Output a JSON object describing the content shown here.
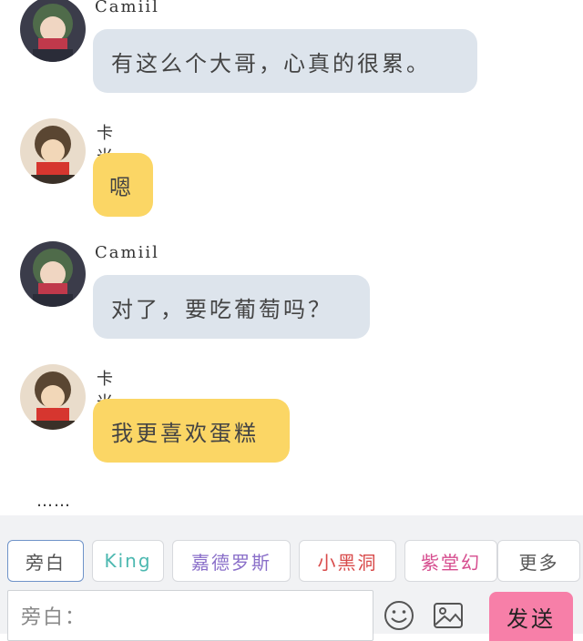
{
  "messages": [
    {
      "sender": "Camiil",
      "text": "有这么个大哥，心真的很累。",
      "style": "grey",
      "avatar": "hooded-character-avatar"
    },
    {
      "sender": "卡米尔",
      "text": "嗯",
      "style": "yellow",
      "avatar": "red-scarf-character-avatar"
    },
    {
      "sender": "Camiil",
      "text": "对了，要吃葡萄吗？",
      "style": "grey",
      "avatar": "hooded-character-avatar"
    },
    {
      "sender": "卡米尔",
      "text": "我更喜欢蛋糕",
      "style": "yellow",
      "avatar": "red-scarf-character-avatar"
    }
  ],
  "ellipsis": "……",
  "tags": [
    {
      "label": "旁白",
      "color": "#555555",
      "active": true
    },
    {
      "label": "King",
      "color": "#4cb8b0",
      "active": false
    },
    {
      "label": "嘉德罗斯",
      "color": "#8a6fc9",
      "active": false
    },
    {
      "label": "小黑洞",
      "color": "#d84a4a",
      "active": false
    },
    {
      "label": "紫堂幻",
      "color": "#d64c8e",
      "active": false
    },
    {
      "label": "更多",
      "color": "#555555",
      "active": false
    }
  ],
  "input": {
    "label": "旁白："
  },
  "toolbar": {
    "emoji_icon": "smiley-icon",
    "image_icon": "image-icon",
    "send_label": "发送"
  },
  "colors": {
    "grey_bubble": "#dde4ec",
    "yellow_bubble": "#fbd665",
    "send": "#f77fa8"
  }
}
